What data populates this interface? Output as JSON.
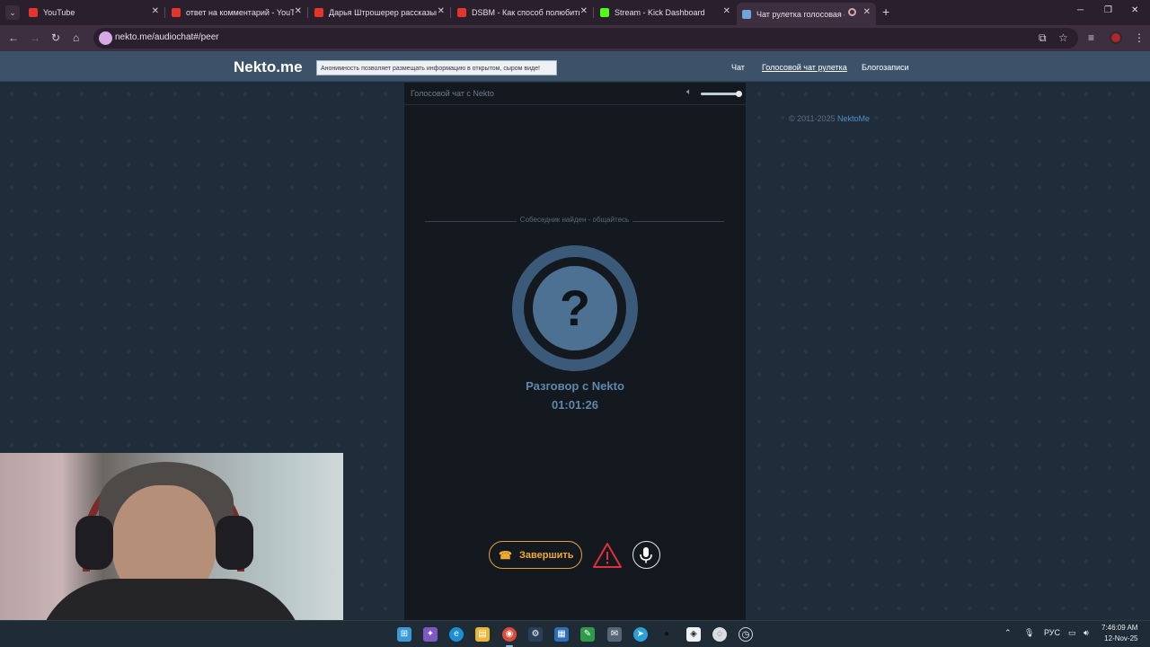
{
  "browser": {
    "tabs": [
      {
        "title": "YouTube",
        "favicon": "youtube-icon"
      },
      {
        "title": "ответ на комментарий - YouTube",
        "favicon": "youtube-icon"
      },
      {
        "title": "Дарья Штрошерер рассказыв",
        "favicon": "youtube-icon"
      },
      {
        "title": "DSBM - Как способ полюбить",
        "favicon": "youtube-icon"
      },
      {
        "title": "Stream - Kick Dashboard",
        "favicon": "kick-icon"
      },
      {
        "title": "Чат рулетка голосовая — N",
        "favicon": "nekto-icon",
        "active": true
      }
    ],
    "url": "nekto.me/audiochat#/peer"
  },
  "site": {
    "logo": "Nekto.me",
    "notice": "Анонимность позволяет размещать информацию в открытом, сыром виде!",
    "nav": [
      {
        "label": "Чат",
        "active": false
      },
      {
        "label": "Голосовой чат рулетка",
        "active": true
      },
      {
        "label": "Блогозаписи",
        "active": false
      }
    ],
    "copyright_prefix": "© 2011-2025",
    "copyright_link": "NektoMe"
  },
  "chat": {
    "title": "Голосовой чат с Nekto",
    "volume": 1.0,
    "status": "Собеседник найден - общайтесь",
    "avatar_symbol": "?",
    "peer_name": "Разговор с Nekto",
    "timer": "01:01:26",
    "end_button": "Завершить",
    "colors": {
      "accent": "#f0aa30",
      "peer": "#5f87ad",
      "report": "#e0303a"
    }
  },
  "taskbar": {
    "lang": "РУС",
    "time": "7:46:09 AM",
    "date": "12-Nov-25"
  }
}
